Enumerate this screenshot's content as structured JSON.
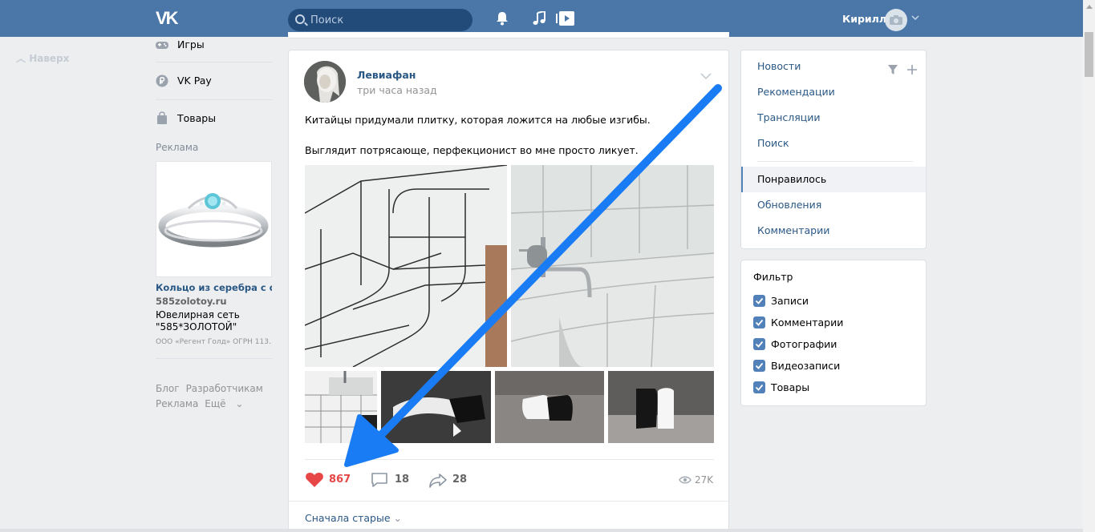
{
  "header": {
    "logo": "VK",
    "search_placeholder": "Поиск",
    "user_name": "Кирилл"
  },
  "back_to_top": "Наверх",
  "left_menu": {
    "items": [
      {
        "label": "Игры",
        "icon": "gamepad-icon"
      },
      {
        "label": "VK Pay",
        "icon": "vkpay-icon"
      },
      {
        "label": "Товары",
        "icon": "shopping-bag-icon"
      }
    ],
    "ads_title": "Реклама",
    "ad": {
      "title": "Кольцо из серебра с фи...",
      "domain": "585zolotoy.ru",
      "desc": "Ювелирная сеть \"585*ЗОЛОТОЙ\"",
      "legal": "ООО «Регент Голд» ОГРН 113..."
    },
    "footer": {
      "blog": "Блог",
      "dev": "Разработчикам",
      "ads": "Реклама",
      "more": "Ещё"
    }
  },
  "post": {
    "author": "Левиафан",
    "time": "три часа назад",
    "text1": "Китайцы придумали плитку, которая ложится на любые изгибы.",
    "text2": "Выглядит потрясающе, перфекционист во мне просто ликует.",
    "likes": "867",
    "comments": "18",
    "shares": "28",
    "views": "27K",
    "sort": "Сначала старые"
  },
  "right_nav": {
    "items": [
      {
        "label": "Новости"
      },
      {
        "label": "Рекомендации"
      },
      {
        "label": "Трансляции"
      },
      {
        "label": "Поиск"
      },
      {
        "label": "Понравилось",
        "active": true
      },
      {
        "label": "Обновления"
      },
      {
        "label": "Комментарии"
      }
    ]
  },
  "filter": {
    "title": "Фильтр",
    "options": [
      {
        "label": "Записи",
        "checked": true
      },
      {
        "label": "Комментарии",
        "checked": true
      },
      {
        "label": "Фотографии",
        "checked": true
      },
      {
        "label": "Видеозаписи",
        "checked": true
      },
      {
        "label": "Товары",
        "checked": true
      }
    ]
  },
  "colors": {
    "header_bg": "#4a76a8",
    "link": "#2a5885",
    "like_red": "#e64646",
    "annotation_arrow": "#1a7cf5"
  }
}
